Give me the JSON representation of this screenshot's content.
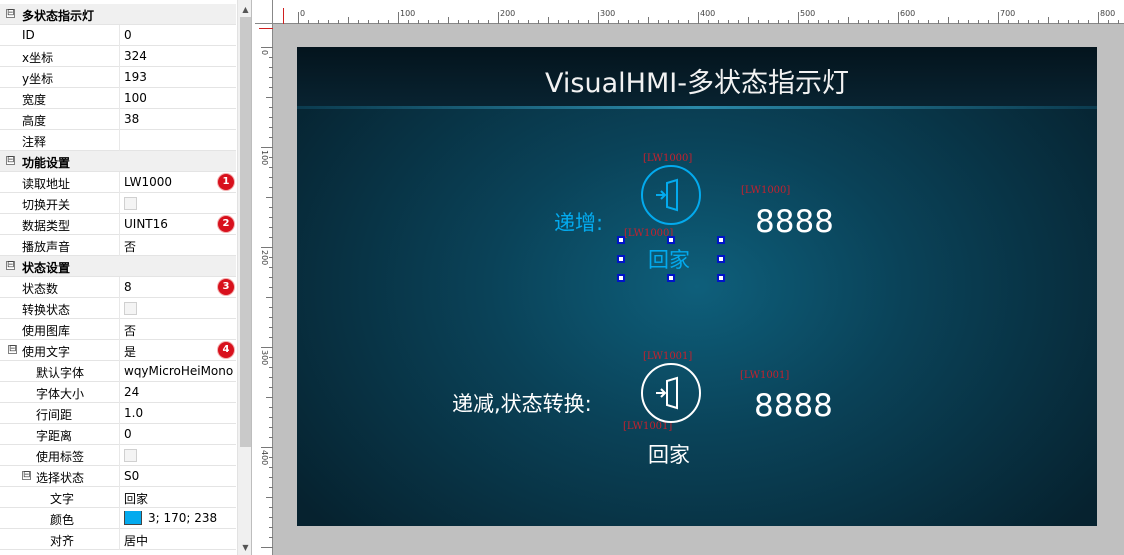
{
  "properties": {
    "cat_main": "多状态指示灯",
    "id_label": "ID",
    "id_value": "0",
    "x_label": "x坐标",
    "x_value": "324",
    "y_label": "y坐标",
    "y_value": "193",
    "w_label": "宽度",
    "w_value": "100",
    "h_label": "高度",
    "h_value": "38",
    "note_label": "注释",
    "note_value": "",
    "cat_func": "功能设置",
    "read_addr_label": "读取地址",
    "read_addr_value": "LW1000",
    "switch_label": "切换开关",
    "dtype_label": "数据类型",
    "dtype_value": "UINT16",
    "sound_label": "播放声音",
    "sound_value": "否",
    "cat_state": "状态设置",
    "state_count_label": "状态数",
    "state_count_value": "8",
    "trans_state_label": "转换状态",
    "use_lib_label": "使用图库",
    "use_lib_value": "否",
    "use_text_label": "使用文字",
    "use_text_value": "是",
    "default_font_label": "默认字体",
    "default_font_value": "wqyMicroHeiMono",
    "font_size_label": "字体大小",
    "font_size_value": "24",
    "line_spacing_label": "行间距",
    "line_spacing_value": "1.0",
    "char_spacing_label": "字距离",
    "char_spacing_value": "0",
    "use_tag_label": "使用标签",
    "select_state_label": "选择状态",
    "select_state_value": "S0",
    "text_label": "文字",
    "text_value": "回家",
    "color_label": "颜色",
    "color_value": "3; 170; 238",
    "align_label": "对齐",
    "align_value": "居中",
    "toggle_symbol": "⊟"
  },
  "badges": [
    "1",
    "2",
    "3",
    "4"
  ],
  "ruler": {
    "h_labels": [
      "0",
      "100",
      "200",
      "300",
      "400",
      "500",
      "600",
      "700",
      "800"
    ],
    "v_labels": [
      "0",
      "100",
      "200",
      "300",
      "400"
    ]
  },
  "screen": {
    "title": "VisualHMI-多状态指示灯",
    "inc_label": "递增:",
    "dec_label": "递减,状态转换:",
    "tag_lw1000": "[LW1000]",
    "tag_lw1001": "[LW1001]",
    "num_value": "8888",
    "state_text": "回家"
  },
  "colors": {
    "accent": "#03aaee",
    "badge": "#d8101c",
    "tag_red": "#c8202c"
  },
  "icons": [
    "door-enter-icon"
  ]
}
